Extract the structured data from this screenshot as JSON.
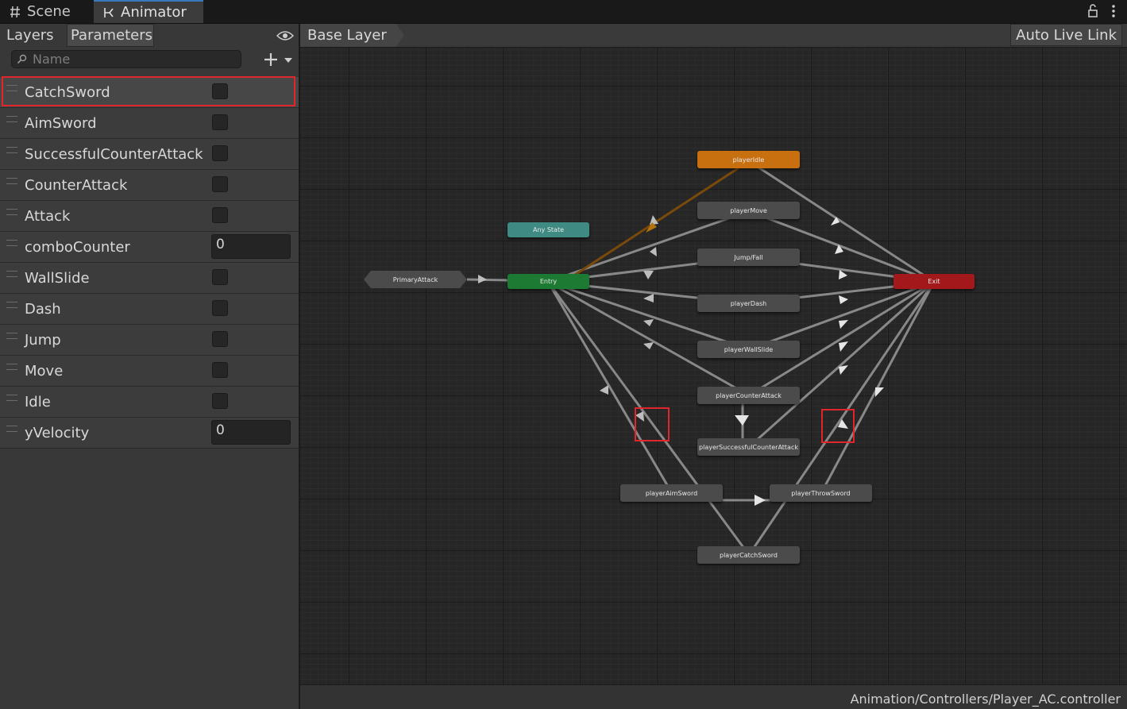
{
  "tabs": {
    "scene": "Scene",
    "animator": "Animator"
  },
  "left_panel": {
    "tabs": {
      "layers": "Layers",
      "parameters": "Parameters"
    },
    "search_placeholder": "Name",
    "parameters": [
      {
        "name": "CatchSword",
        "type": "bool",
        "selected": true
      },
      {
        "name": "AimSword",
        "type": "bool"
      },
      {
        "name": "SuccessfulCounterAttack",
        "type": "bool"
      },
      {
        "name": "CounterAttack",
        "type": "bool"
      },
      {
        "name": "Attack",
        "type": "bool"
      },
      {
        "name": "comboCounter",
        "type": "int",
        "value": "0"
      },
      {
        "name": "WallSlide",
        "type": "bool"
      },
      {
        "name": "Dash",
        "type": "bool"
      },
      {
        "name": "Jump",
        "type": "bool"
      },
      {
        "name": "Move",
        "type": "bool"
      },
      {
        "name": "Idle",
        "type": "bool"
      },
      {
        "name": "yVelocity",
        "type": "float",
        "value": "0"
      }
    ]
  },
  "graph": {
    "breadcrumb": "Base Layer",
    "live_link": "Auto Live Link",
    "footer_path": "Animation/Controllers/Player_AC.controller",
    "nodes": {
      "idle": "playerIdle",
      "move": "playerMove",
      "jump": "Jump/Fall",
      "dash": "playerDash",
      "wallslide": "playerWallSlide",
      "counter": "playerCounterAttack",
      "successcounter": "playerSuccessfulCounterAttack",
      "aim": "playerAimSword",
      "throw": "playerThrowSword",
      "catch": "playerCatchSword",
      "anystate": "Any State",
      "entry": "Entry",
      "exit": "Exit",
      "primary": "PrimaryAttack"
    },
    "colors": {
      "default": "#4b4b4b",
      "idle": "#c8700f",
      "anystate": "#3f8a83",
      "entry": "#1c7a32",
      "exit": "#a3181b",
      "highlight": "#e0262b"
    }
  }
}
